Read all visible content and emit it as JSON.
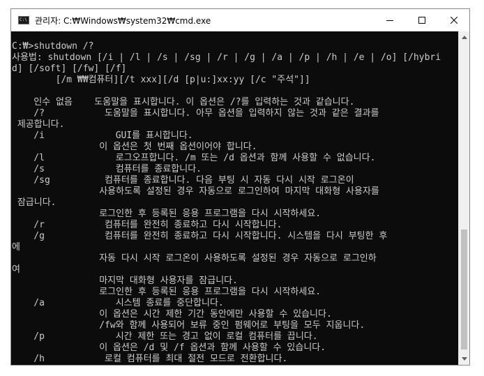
{
  "window": {
    "title": "관리자: C:₩Windows₩system32₩cmd.exe",
    "icon_text": "C:\\",
    "buttons": {
      "minimize": "minimize-icon",
      "maximize": "maximize-icon",
      "close": "close-icon"
    }
  },
  "colors": {
    "console_background": "#0c0c0c",
    "console_text": "#cccccc",
    "titlebar": "#ffffff",
    "scrollbar_track": "#f0f0f0",
    "scrollbar_thumb": "#c1c1c1"
  },
  "console": {
    "lines": [
      "C:₩>shutdown /?",
      "사용법: shutdown [/i | /l | /s | /sg | /r | /g | /a | /p | /h | /e | /o] [/hybri",
      "d] [/soft] [/fw] [/f]",
      "        [/m ₩₩컴퓨터][/t xxx][/d [p|u:]xx:yy [/c \"주석\"]]",
      "",
      "    인수 없음    도움말을 표시합니다. 이 옵션은 /?를 입력하는 것과 같습니다.",
      "    /?           도움말을 표시합니다. 아무 옵션을 입력하지 않는 것과 같은 결과를",
      " 제공합니다.",
      "    /i             GUI를 표시합니다.",
      "                이 옵션은 첫 번째 옵션이어야 합니다.",
      "    /l             로그오프합니다. /m 또는 /d 옵션과 함께 사용할 수 없습니다.",
      "    /s             컴퓨터를 종료합니다.",
      "    /sg          컴퓨터를 종료합니다. 다음 부팅 시 자동 다시 시작 로그온이",
      "                사용하도록 설정된 경우 자동으로 로그인하여 마지막 대화형 사용자를",
      " 잠급니다.",
      "                로그인한 후 등록된 응용 프로그램을 다시 시작하세요.",
      "    /r           컴퓨터를 완전히 종료하고 다시 시작합니다.",
      "    /g           컴퓨터를 완전히 종료하고 다시 시작합니다. 시스템을 다시 부팅한 후",
      "에",
      "                자동 다시 시작 로그온이 사용하도록 설정된 경우 자동으로 로그인하",
      "여",
      "                마지막 대화형 사용자를 잠급니다.",
      "                로그인한 후 등록된 응용 프로그램을 다시 시작하세요.",
      "    /a             시스템 종료를 중단합니다.",
      "                이 옵션은 시간 제한 기간 동안에만 사용할 수 있습니다.",
      "                /fw와 함께 사용되어 보류 중인 펌웨어로 부팅을 모두 지웁니다.",
      "    /p             시간 제한 또는 경고 없이 로컬 컴퓨터를 끕니다.",
      "                이 옵션은 /d 및 /f 옵션과 함께 사용할 수 있습니다.",
      "    /h           로컬 컴퓨터를 최대 절전 모드로 전환합니다."
    ]
  }
}
